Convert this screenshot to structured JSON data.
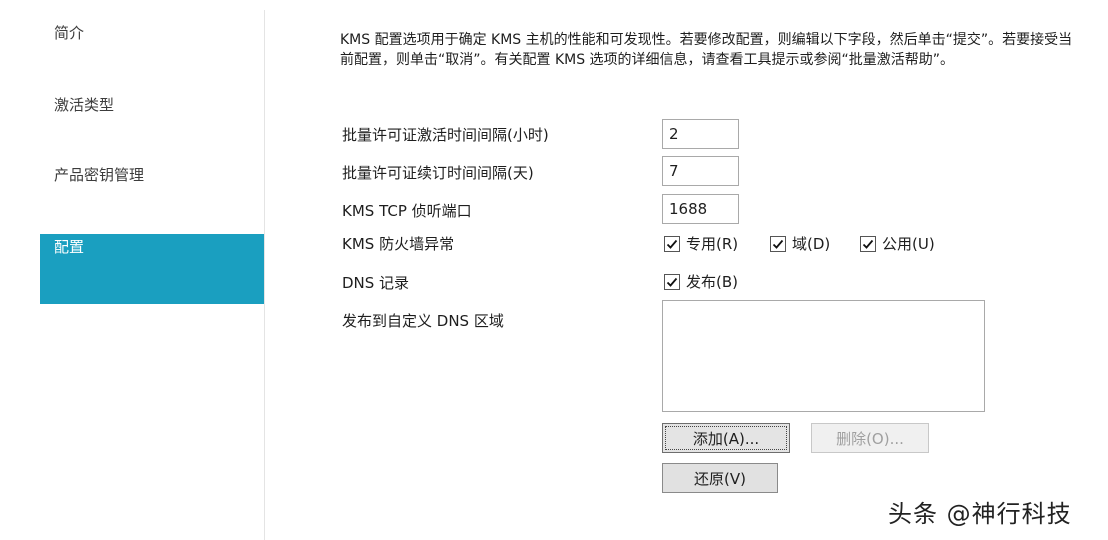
{
  "sidebar": {
    "items": [
      {
        "label": "简介",
        "selected": false
      },
      {
        "label": "激活类型",
        "selected": false
      },
      {
        "label": "产品密钥管理",
        "selected": false
      },
      {
        "label": "配置",
        "selected": true
      }
    ]
  },
  "description": "KMS 配置选项用于确定 KMS 主机的性能和可发现性。若要修改配置，则编辑以下字段，然后单击“提交”。若要接受当前配置，则单击“取消”。有关配置 KMS 选项的详细信息，请查看工具提示或参阅“批量激活帮助”。",
  "fields": {
    "activation_interval": {
      "label": "批量许可证激活时间间隔(小时)",
      "value": "2"
    },
    "renewal_interval": {
      "label": "批量许可证续订时间间隔(天)",
      "value": "7"
    },
    "tcp_port": {
      "label": "KMS TCP 侦听端口",
      "value": "1688"
    },
    "firewall": {
      "label": "KMS 防火墙异常",
      "options": [
        {
          "label": "专用(R)",
          "checked": true
        },
        {
          "label": "域(D)",
          "checked": true
        },
        {
          "label": "公用(U)",
          "checked": true
        }
      ]
    },
    "dns_record": {
      "label": "DNS 记录",
      "publish": {
        "label": "发布(B)",
        "checked": true
      }
    },
    "custom_dns": {
      "label": "发布到自定义 DNS 区域",
      "entries": []
    }
  },
  "buttons": {
    "add": "添加(A)...",
    "delete": "删除(O)...",
    "restore": "还原(V)"
  },
  "watermark": "头条 @神行科技",
  "colors": {
    "accent": "#1a9fc0"
  }
}
